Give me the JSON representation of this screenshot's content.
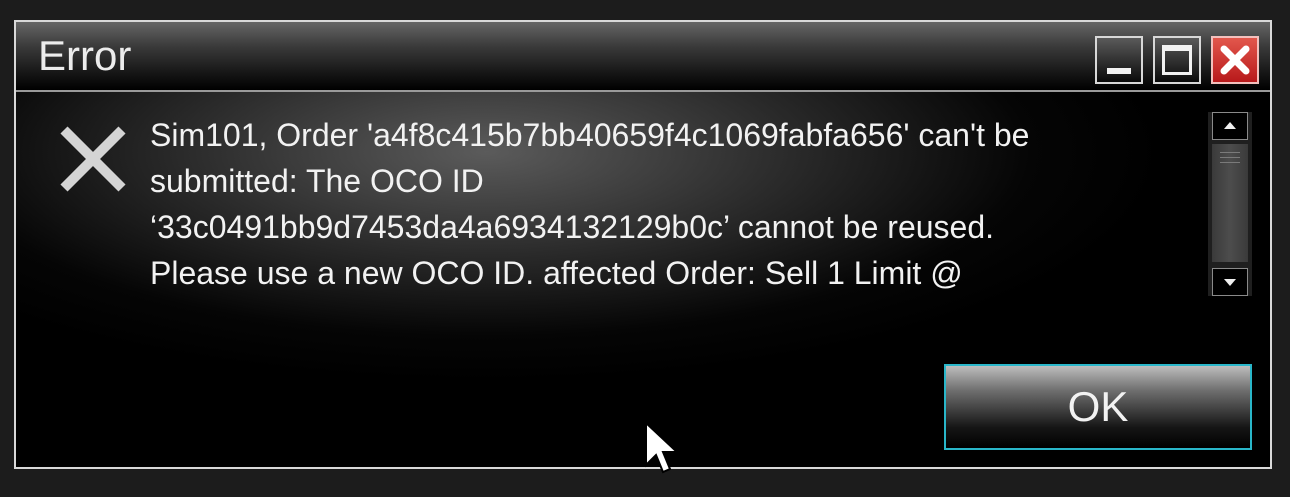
{
  "dialog": {
    "title": "Error",
    "window_controls": {
      "minimize_icon": "minimize-icon",
      "maximize_icon": "maximize-icon",
      "close_icon": "close-icon",
      "close_color": "#c9302c"
    },
    "icon": "error-x-icon",
    "message_lines": [
      "Sim101, Order 'a4f8c415b7bb40659f4c1069fabfa656' can't be",
      "submitted: The OCO ID",
      "‘33c0491bb9d7453da4a6934132129b0c’ cannot be reused.",
      "Please use a new OCO ID. affected Order: Sell 1 Limit @"
    ],
    "ok_label": "OK",
    "ok_border_color": "#29b6c9"
  }
}
